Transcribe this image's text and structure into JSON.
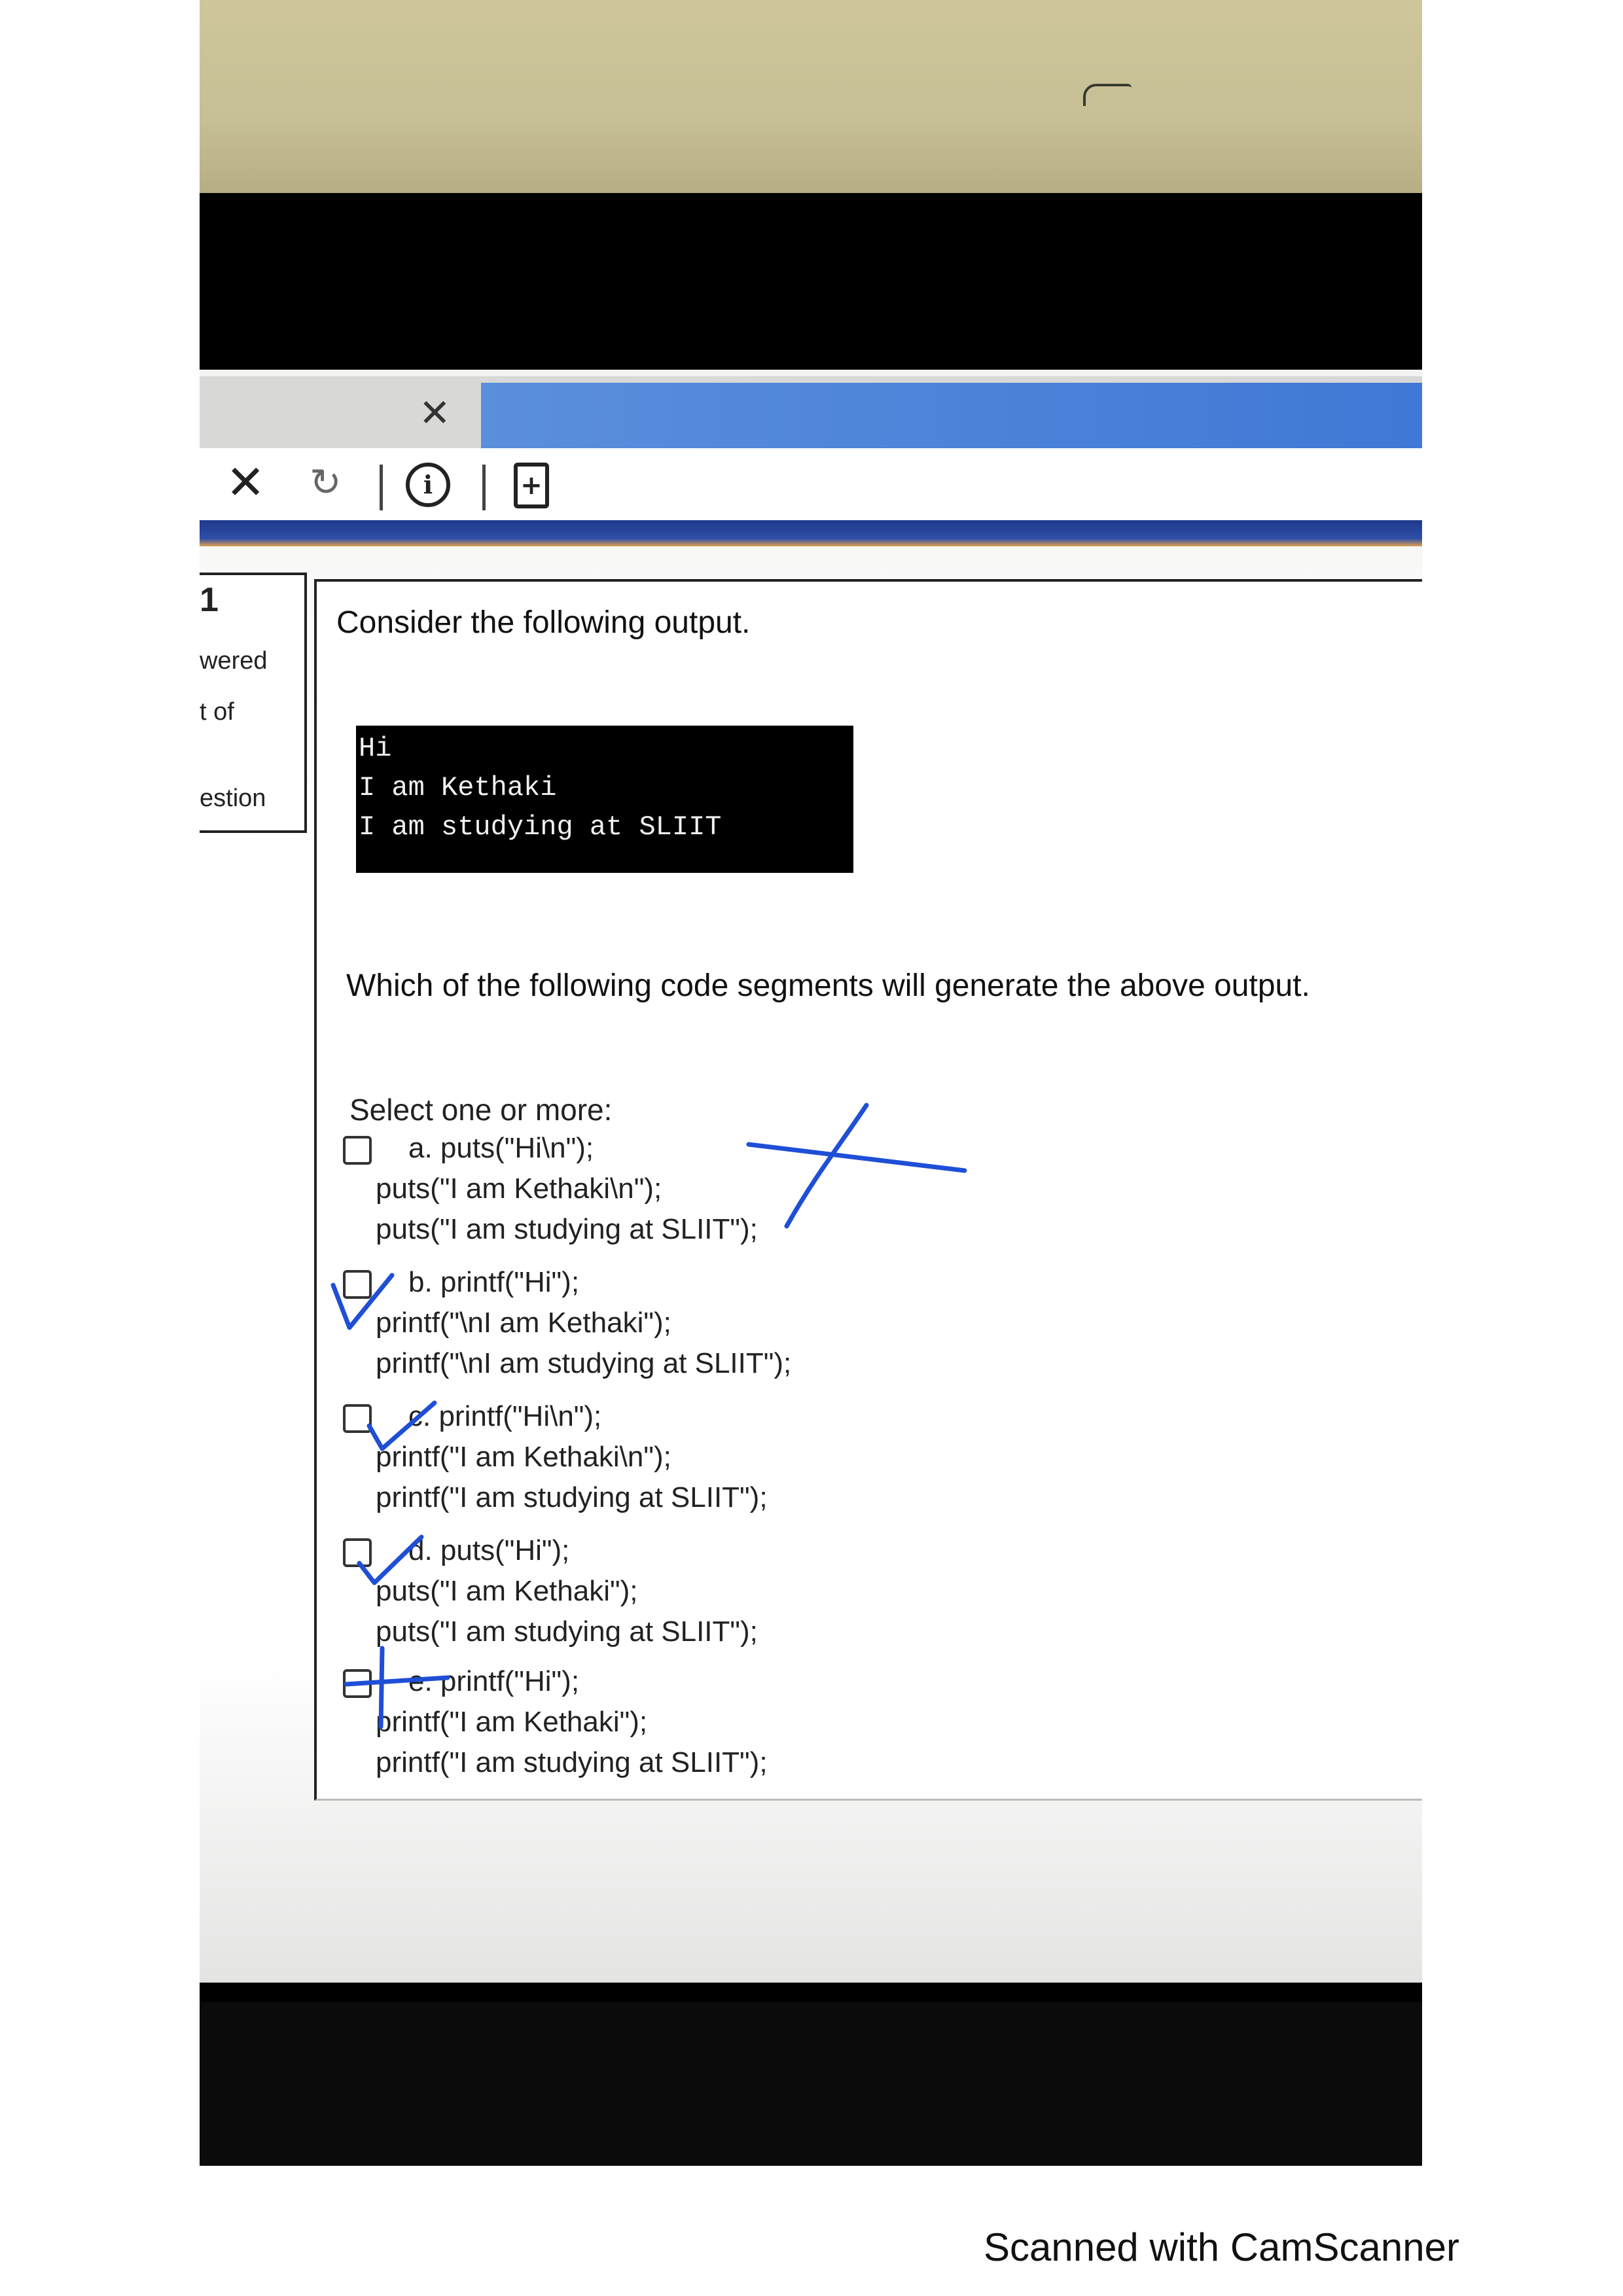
{
  "browser": {
    "tab_close_glyph": "✕",
    "stop_glyph": "✕",
    "reload_glyph": "↻",
    "info_glyph": "i",
    "new_doc_glyph": "+",
    "icons": [
      "close-icon",
      "stop-icon",
      "reload-icon",
      "info-icon",
      "new-document-icon"
    ]
  },
  "sidebar_fragments": [
    "1",
    "wered",
    "t of",
    "estion"
  ],
  "quiz": {
    "prompt": "Consider the following output.",
    "console_output": [
      "Hi",
      "I am Kethaki",
      "I am studying at SLIIT"
    ],
    "question": "Which of the following code segments will generate the above output.",
    "select_label": "Select one or more:",
    "options": [
      {
        "lines": [
          "a. puts(\"Hi\\n\");",
          "puts(\"I am Kethaki\\n\");",
          "puts(\"I am studying at SLIIT\");"
        ],
        "checked": false
      },
      {
        "lines": [
          "b. printf(\"Hi\");",
          "printf(\"\\nI am Kethaki\");",
          "printf(\"\\nI am studying at SLIIT\");"
        ],
        "checked": true
      },
      {
        "lines": [
          "c. printf(\"Hi\\n\");",
          "printf(\"I am Kethaki\\n\");",
          "printf(\"I am studying at SLIIT\");"
        ],
        "checked": true
      },
      {
        "lines": [
          "d. puts(\"Hi\");",
          "puts(\"I am Kethaki\");",
          "puts(\"I am studying at SLIIT\");"
        ],
        "checked": true
      },
      {
        "lines": [
          "e. printf(\"Hi\");",
          "printf(\"I am Kethaki\");",
          "printf(\"I am studying at SLIIT\");"
        ],
        "checked": false
      }
    ]
  },
  "footer": {
    "watermark": "Scanned with CamScanner"
  },
  "colors": {
    "ink_blue": "#1f4fd6",
    "console_bg": "#000000",
    "browser_blue": "#3f78d6"
  }
}
